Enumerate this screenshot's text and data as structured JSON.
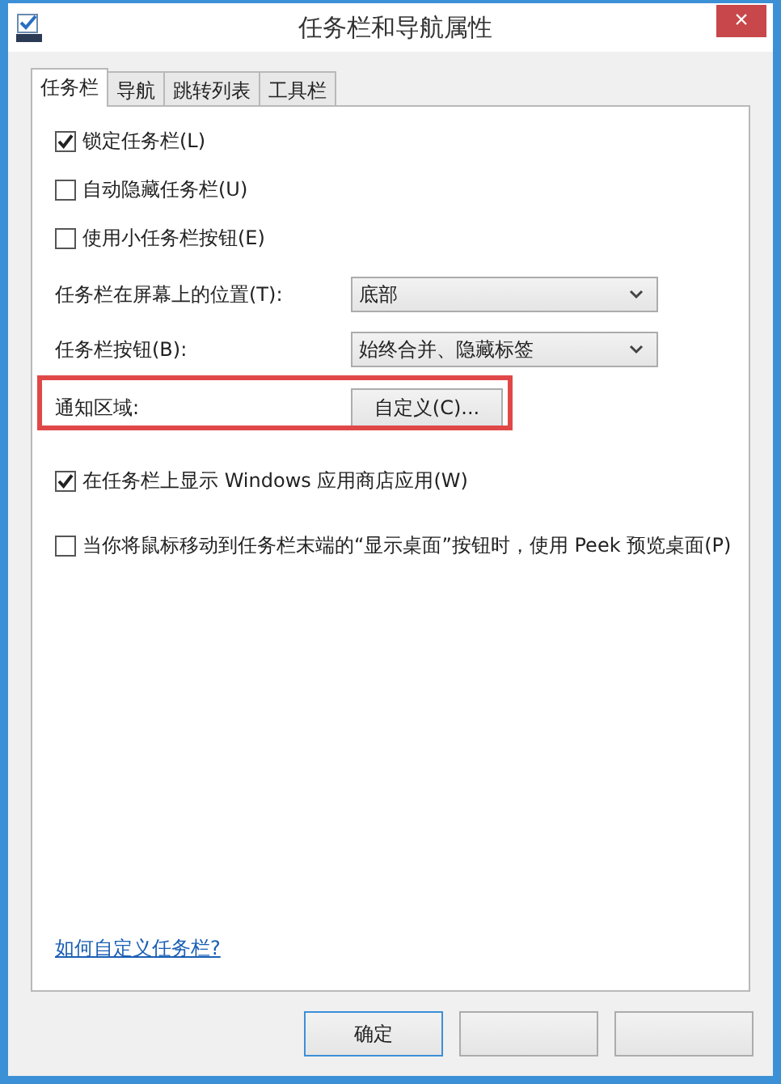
{
  "window": {
    "title": "任务栏和导航属性",
    "close": "×"
  },
  "tabs": [
    {
      "label": "任务栏",
      "selected": true
    },
    {
      "label": "导航",
      "selected": false
    },
    {
      "label": "跳转列表",
      "selected": false
    },
    {
      "label": "工具栏",
      "selected": false
    }
  ],
  "options": [
    {
      "label": "锁定任务栏(L)",
      "checked": true
    },
    {
      "label": "自动隐藏任务栏(U)",
      "checked": false
    },
    {
      "label": "使用小任务栏按钮(E)",
      "checked": false
    }
  ],
  "dropdowns": [
    {
      "label": "任务栏在屏幕上的位置(T):",
      "value": "底部"
    },
    {
      "label": "任务栏按钮(B):",
      "value": "始终合并、隐藏标签"
    }
  ],
  "notification_area": {
    "label": "通知区域:",
    "button": "自定义(C)...",
    "highlighted": true
  },
  "more_options": [
    {
      "label": "在任务栏上显示 Windows 应用商店应用(W)",
      "checked": true
    },
    {
      "label": "当你将鼠标移动到任务栏末端的“显示桌面”按钮时，使用 Peek 预览桌面(P)",
      "checked": false
    }
  ],
  "help_link": "如何自定义任务栏?",
  "buttons": [
    "确定"
  ]
}
